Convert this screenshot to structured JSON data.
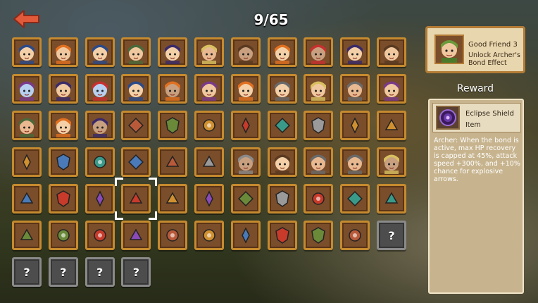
{
  "header": {
    "counter": "9/65",
    "back_icon": "back-arrow-icon"
  },
  "bond": {
    "title": "Good Friend 3",
    "subtitle": "Unlock Archer's Bond Effect"
  },
  "reward": {
    "title": "Reward",
    "item_name": "Eclipse Shield",
    "item_type": "Item",
    "description": "Archer: When the bond is active, max HP recovery is capped at 45%, attack speed +300%, and +10% chance for explosive arrows."
  },
  "collection": {
    "rows": [
      [
        "portrait",
        "portrait",
        "portrait",
        "portrait",
        "portrait",
        "portrait",
        "portrait",
        "portrait",
        "portrait",
        "portrait",
        "portrait"
      ],
      [
        "portrait",
        "portrait",
        "portrait",
        "portrait",
        "portrait",
        "portrait",
        "portrait",
        "portrait",
        "portrait",
        "portrait",
        "portrait"
      ],
      [
        "portrait",
        "portrait",
        "portrait",
        "item",
        "item",
        "item",
        "item",
        "item",
        "item",
        "item",
        "item"
      ],
      [
        "item",
        "item",
        "item",
        "item",
        "item",
        "item",
        "portrait",
        "portrait",
        "portrait",
        "portrait",
        "portrait"
      ],
      [
        "item",
        "item",
        "item",
        "item",
        "item",
        "item",
        "item",
        "item",
        "item",
        "item",
        "item"
      ],
      [
        "item",
        "item",
        "item",
        "item",
        "item",
        "item",
        "item",
        "item",
        "item",
        "item",
        "locked"
      ],
      [
        "locked",
        "locked",
        "locked",
        "locked"
      ]
    ],
    "locked_label": "?",
    "selected": {
      "row": 4,
      "col": 3
    }
  },
  "colors": {
    "portrait_skins": [
      "#f0c8a0",
      "#e8b890",
      "#f4d0a8",
      "#c8a080",
      "#b8d0f0"
    ],
    "portrait_hair": [
      "#5a3a20",
      "#c83030",
      "#e07020",
      "#6a6a6a",
      "#3a2a6a",
      "#2a4a8a",
      "#8a8a8a",
      "#d8c060",
      "#4a6a3a",
      "#7a3a8a"
    ],
    "item_palette": [
      "#c83a2a",
      "#6a8a3a",
      "#4a7ab8",
      "#d09030",
      "#8a4ab8",
      "#3a9a8a",
      "#b85a3a",
      "#9a9a9a"
    ]
  }
}
